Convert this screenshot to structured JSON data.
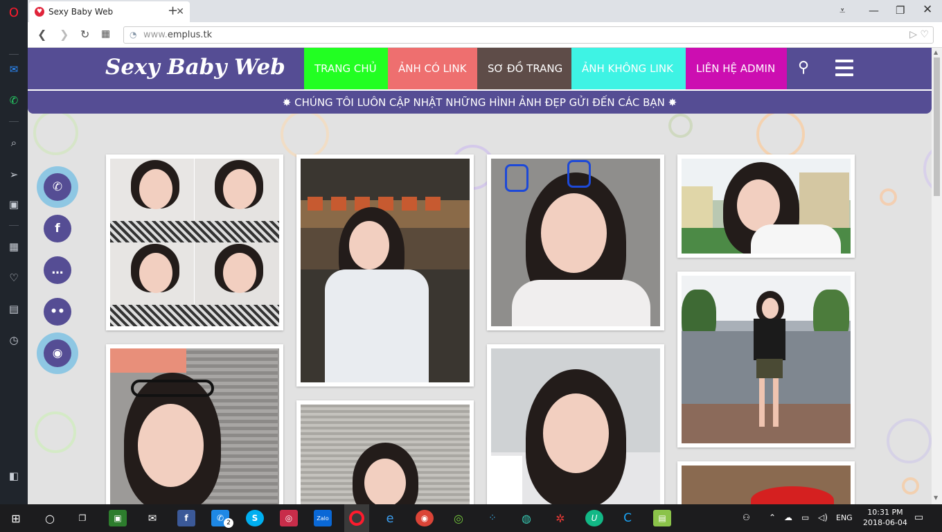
{
  "browser": {
    "tab_title": "Sexy Baby Web",
    "url_prefix": "www.",
    "url_domain": "emplus.tk"
  },
  "site": {
    "logo": "Sexy Baby Web",
    "menu": [
      {
        "label": "TRANG CHỦ",
        "color": "#22ff22"
      },
      {
        "label": "ẢNH CÓ LINK",
        "color": "#ee6f6f"
      },
      {
        "label": "SƠ ĐỒ TRANG",
        "color": "#5e4c48"
      },
      {
        "label": "ẢNH KHÔNG LINK",
        "color": "#3ef3e4"
      },
      {
        "label": "LIÊN HỆ ADMIN",
        "color": "#cc0eb1"
      }
    ],
    "marquee": "✸ CHÚNG TÔI LUÔN CẬP NHẬT NHỮNG HÌNH ẢNH ĐẸP GỬI ĐẾN CÁC BẠN ✸",
    "header_color": "#554d94"
  },
  "social_buttons": [
    {
      "icon": "phone-icon",
      "glyph": "✆"
    },
    {
      "icon": "facebook-icon",
      "glyph": "f"
    },
    {
      "icon": "chat-bubble-icon",
      "glyph": "…"
    },
    {
      "icon": "wechat-icon",
      "glyph": "••"
    },
    {
      "icon": "user-icon",
      "glyph": "◉"
    }
  ],
  "taskbar": {
    "messenger_badge": "2",
    "tray_language": "ENG",
    "time": "10:31 PM",
    "date": "2018-06-04"
  }
}
